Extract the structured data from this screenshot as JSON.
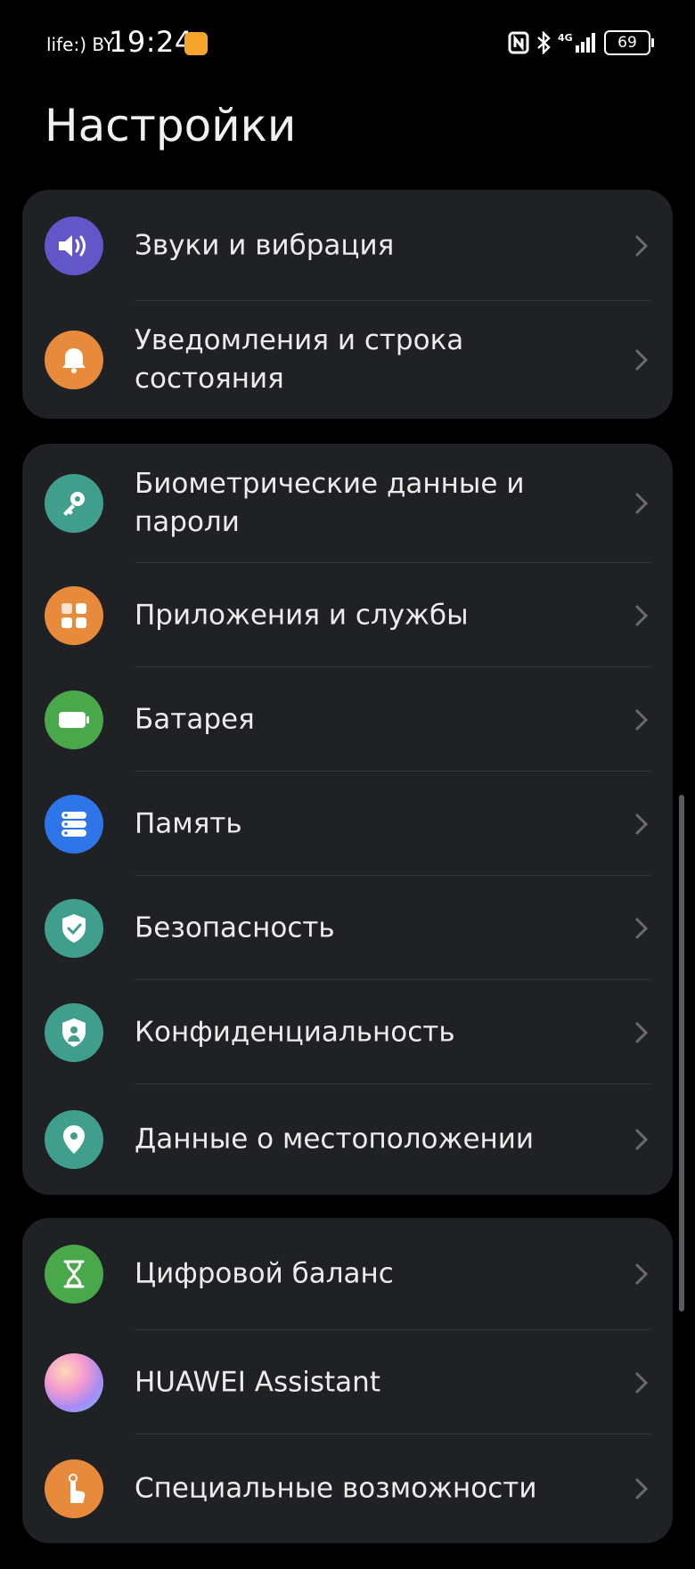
{
  "status_bar": {
    "carrier": "life:) BY",
    "time": "19:24",
    "battery": "69"
  },
  "page": {
    "title": "Настройки"
  },
  "groups": [
    [
      {
        "label": "Звуки и вибрация",
        "icon": "speaker-icon",
        "color": "#6256c9"
      },
      {
        "label": "Уведомления и строка состояния",
        "icon": "bell-icon",
        "color": "#e88a3b"
      }
    ],
    [
      {
        "label": "Биометрические данные и пароли",
        "icon": "key-icon",
        "color": "#3f9f8c"
      },
      {
        "label": "Приложения и службы",
        "icon": "apps-grid-icon",
        "color": "#e88a3b"
      },
      {
        "label": "Батарея",
        "icon": "battery-icon",
        "color": "#49a94a"
      },
      {
        "label": "Память",
        "icon": "storage-icon",
        "color": "#2f75ea"
      },
      {
        "label": "Безопасность",
        "icon": "shield-check-icon",
        "color": "#3f9f8c"
      },
      {
        "label": "Конфиденциальность",
        "icon": "privacy-shield-icon",
        "color": "#3f9f8c"
      },
      {
        "label": "Данные о местоположении",
        "icon": "location-pin-icon",
        "color": "#3f9f8c"
      }
    ],
    [
      {
        "label": "Цифровой баланс",
        "icon": "hourglass-icon",
        "color": "#49a94a"
      },
      {
        "label": "HUAWEI Assistant",
        "icon": "huawei-assistant-icon",
        "color": "#f59ccd"
      },
      {
        "label": "Специальные возможности",
        "icon": "accessibility-hand-icon",
        "color": "#e88a3b"
      }
    ]
  ]
}
